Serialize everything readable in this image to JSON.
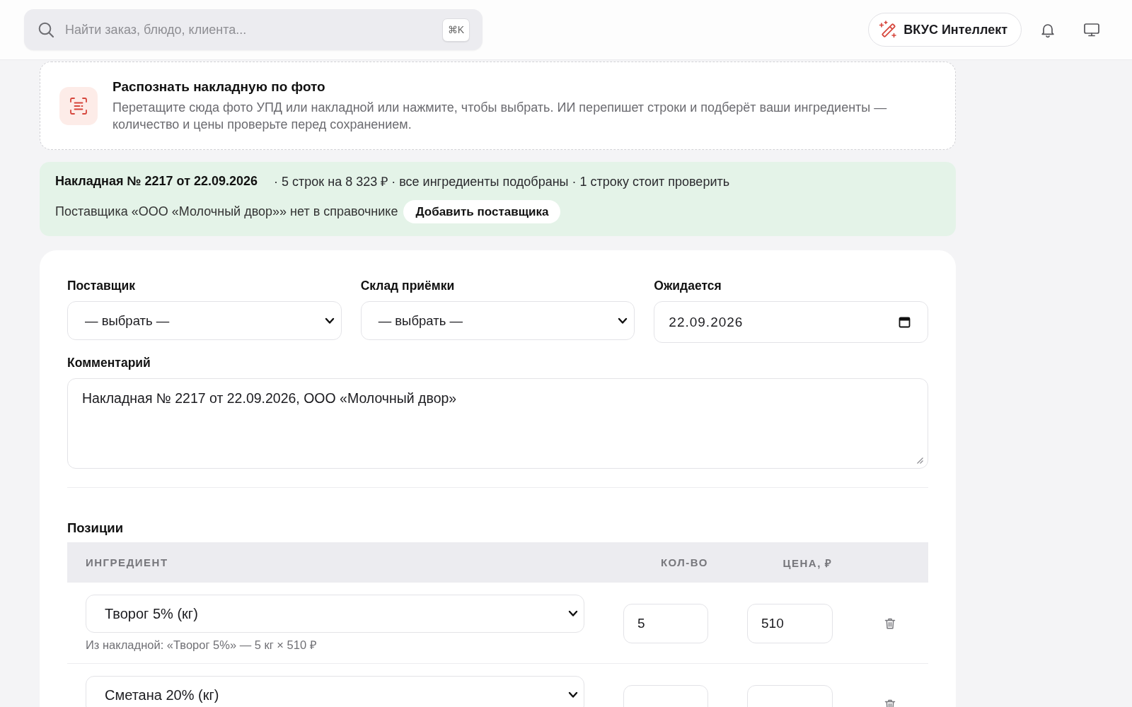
{
  "top_bar": {
    "search": {
      "placeholder": "Найти заказ, блюдо, клиента...",
      "shortcut": "⌘K"
    },
    "assistant_button": {
      "label": "ВКУС Интеллект"
    }
  },
  "upload_card": {
    "title": "Распознать накладную по фото",
    "description": "Перетащите сюда фото УПД или накладной или нажмите, чтобы выбрать. ИИ перепишет строки и подберёт ваши ингредиенты — количество и цены проверьте перед сохранением."
  },
  "invoice_banner": {
    "title": "Накладная № 2217 от 22.09.2026",
    "summary": "· 5 строк на 8 323 ₽ · все ингредиенты подобраны · 1 строку стоит проверить",
    "notice": "Поставщика «ООО «Молочный двор»» нет в справочнике",
    "action": "Добавить поставщика"
  },
  "form": {
    "fields": [
      {
        "label": "Поставщик",
        "kind": "select",
        "value": "— выбрать —"
      },
      {
        "label": "Склад приёмки",
        "kind": "select",
        "value": "— выбрать —"
      },
      {
        "label": "Ожидается",
        "kind": "date",
        "value": "22.09.2026"
      }
    ],
    "comment": {
      "label": "Комментарий",
      "value": "Накладная № 2217 от 22.09.2026, ООО «Молочный двор»"
    }
  },
  "positions": {
    "title": "Позиции",
    "columns": [
      "ИНГРЕДИЕНТ",
      "КОЛ-ВО",
      "ЦЕНА, ₽"
    ],
    "rows": [
      {
        "ingredient": "Творог 5% (кг)",
        "hint": "Из накладной: «Творог 5%» — 5 кг × 510 ₽",
        "quantity": "5",
        "price": "510"
      },
      {
        "ingredient": "Сметана 20% (кг)"
      }
    ]
  }
}
